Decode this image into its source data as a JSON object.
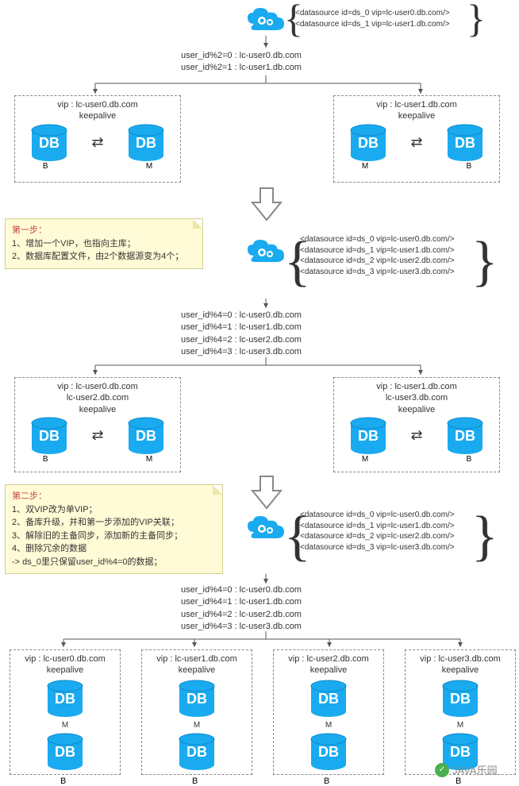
{
  "top": {
    "ds": [
      "<datasource id=ds_0 vip=lc-user0.db.com/>",
      "<datasource id=ds_1 vip=lc-user1.db.com/>"
    ],
    "routing": [
      "user_id%2=0 : lc-user0.db.com",
      "user_id%2=1 : lc-user1.db.com"
    ]
  },
  "cluster1_left": {
    "vip": "vip : lc-user0.db.com",
    "ka": "keepalive",
    "roles": [
      "B",
      "M"
    ]
  },
  "cluster1_right": {
    "vip": "vip : lc-user1.db.com",
    "ka": "keepalive",
    "roles": [
      "M",
      "B"
    ]
  },
  "step1": {
    "title": "第一步：",
    "lines": [
      "1、增加一个VIP，也指向主库；",
      "2、数据库配置文件，由2个数据源变为4个；"
    ],
    "ds": [
      "<datasource id=ds_0 vip=lc-user0.db.com/>",
      "<datasource id=ds_1 vip=lc-user1.db.com/>",
      "<datasource id=ds_2 vip=lc-user2.db.com/>",
      "<datasource id=ds_3 vip=lc-user3.db.com/>"
    ],
    "routing": [
      "user_id%4=0 : lc-user0.db.com",
      "user_id%4=1 : lc-user1.db.com",
      "user_id%4=2 : lc-user2.db.com",
      "user_id%4=3 : lc-user3.db.com"
    ]
  },
  "cluster2_left": {
    "vip": "vip : lc-user0.db.com",
    "vip2": "lc-user2.db.com",
    "ka": "keepalive",
    "roles": [
      "B",
      "M"
    ]
  },
  "cluster2_right": {
    "vip": "vip : lc-user1.db.com",
    "vip2": "lc-user3.db.com",
    "ka": "keepalive",
    "roles": [
      "M",
      "B"
    ]
  },
  "step2": {
    "title": "第二步：",
    "lines": [
      "1、双VIP改为单VIP；",
      "2、备库升级，并和第一步添加的VIP关联；",
      "3、解除旧的主备同步，添加新的主备同步；",
      "4、删除冗余的数据",
      "    -> ds_0里只保留user_id%4=0的数据；"
    ],
    "ds": [
      "<datasource id=ds_0 vip=lc-user0.db.com/>",
      "<datasource id=ds_1 vip=lc-user1.db.com/>",
      "<datasource id=ds_2 vip=lc-user2.db.com/>",
      "<datasource id=ds_3 vip=lc-user3.db.com/>"
    ],
    "routing": [
      "user_id%4=0 : lc-user0.db.com",
      "user_id%4=1 : lc-user1.db.com",
      "user_id%4=2 : lc-user2.db.com",
      "user_id%4=3 : lc-user3.db.com"
    ]
  },
  "final_cols": [
    {
      "vip": "vip : lc-user0.db.com",
      "ka": "keepalive",
      "top": "M",
      "bot": "B"
    },
    {
      "vip": "vip : lc-user1.db.com",
      "ka": "keepalive",
      "top": "M",
      "bot": "B"
    },
    {
      "vip": "vip : lc-user2.db.com",
      "ka": "keepalive",
      "top": "M",
      "bot": "B"
    },
    {
      "vip": "vip : lc-user3.db.com",
      "ka": "keepalive",
      "top": "M",
      "bot": "B"
    }
  ],
  "db_label": "DB",
  "watermark": "JAVA乐园"
}
